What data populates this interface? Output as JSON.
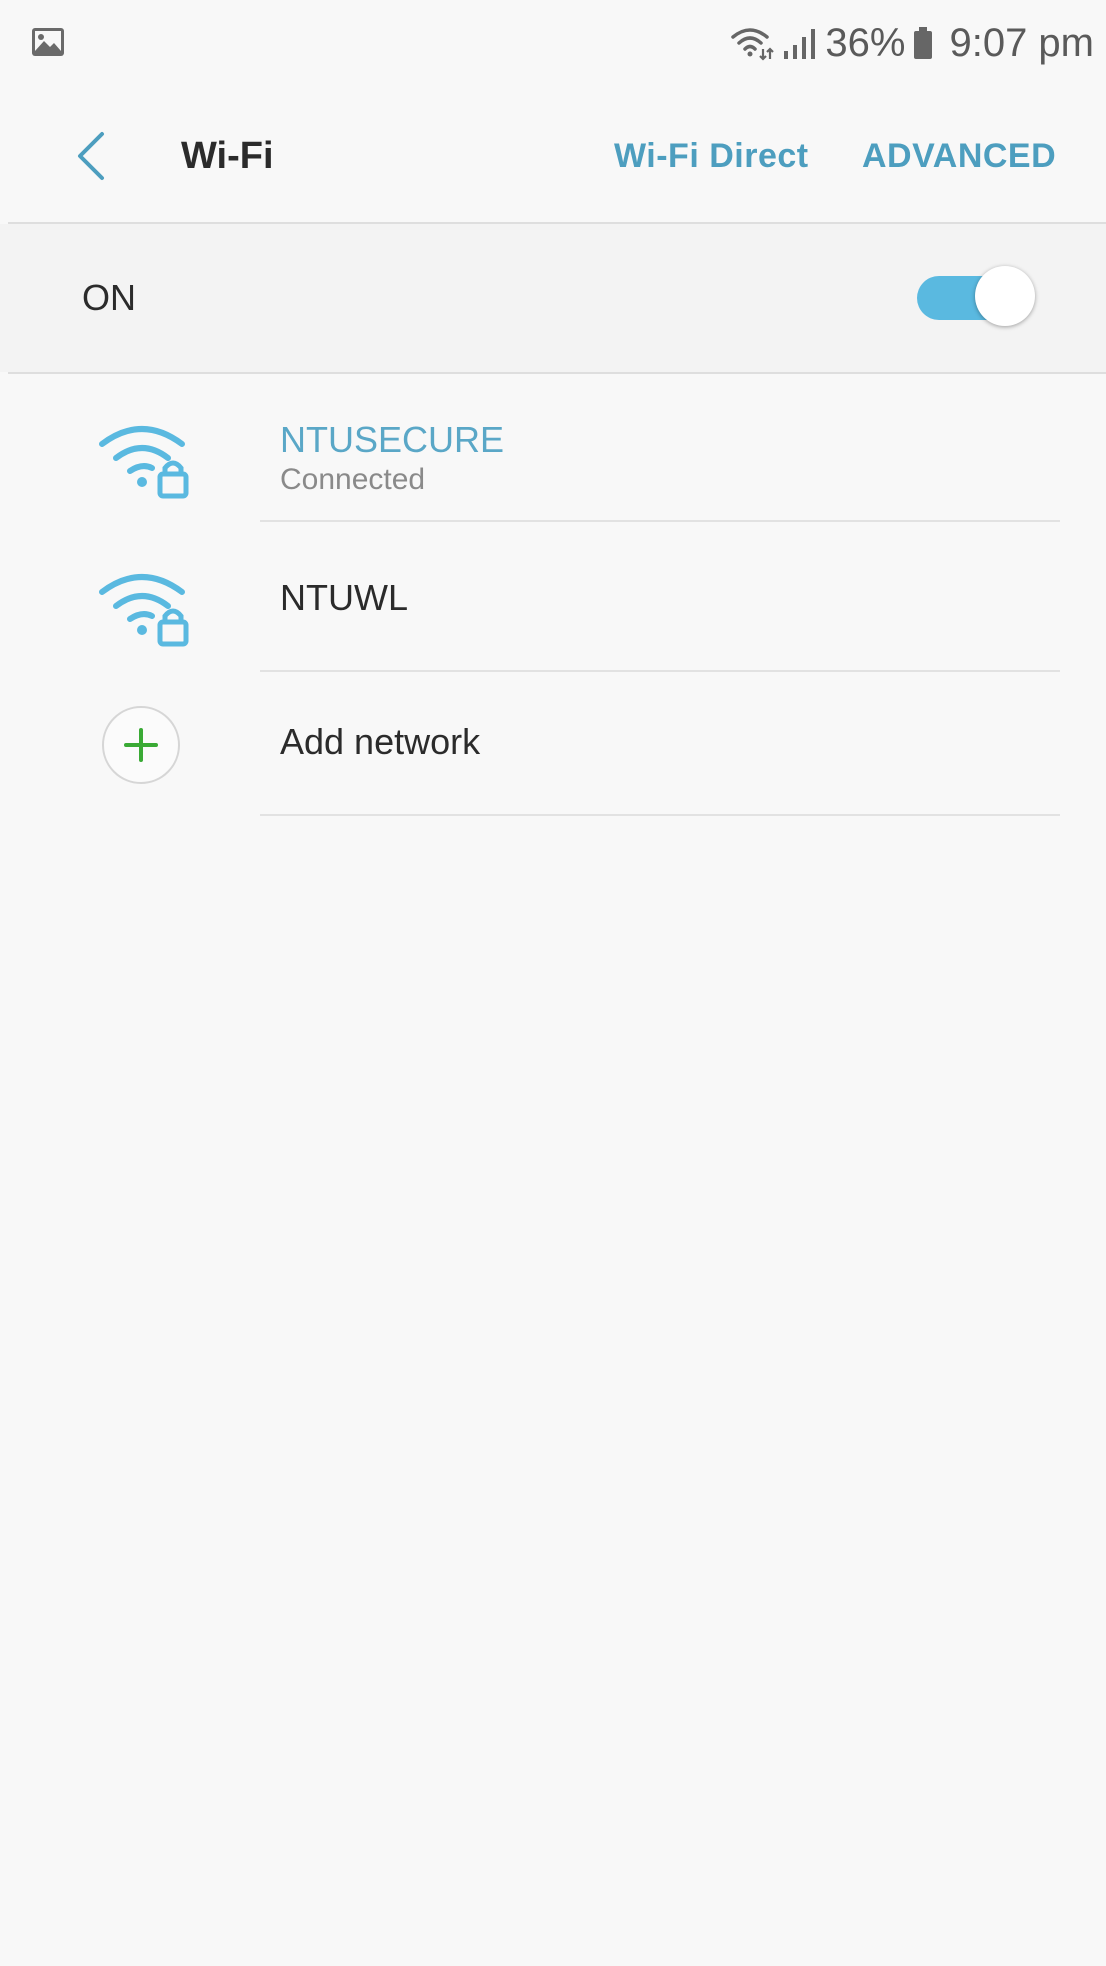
{
  "status_bar": {
    "gallery_icon": "image-notification-icon",
    "wifi_icon": "wifi-activity-icon",
    "signal_icon": "cell-signal-icon",
    "battery_percent": "36%",
    "battery_icon": "battery-icon",
    "time": "9:07 pm"
  },
  "app_bar": {
    "back_icon": "chevron-left-icon",
    "title": "Wi-Fi",
    "wifi_direct_label": "Wi-Fi Direct",
    "advanced_label": "ADVANCED"
  },
  "toggle": {
    "label": "ON",
    "state": true,
    "accent_color": "#5ab9e0"
  },
  "networks": [
    {
      "ssid": "NTUSECURE",
      "status": "Connected",
      "secured": true,
      "connected": true,
      "icon": "wifi-lock-icon"
    },
    {
      "ssid": "NTUWL",
      "status": "",
      "secured": true,
      "connected": false,
      "icon": "wifi-lock-icon"
    }
  ],
  "add_network": {
    "label": "Add network",
    "icon": "plus-icon"
  },
  "colors": {
    "accent": "#4d9ebf",
    "connected_text": "#5aa7c7",
    "add_green": "#3aaa35",
    "background": "#f8f8f8"
  }
}
